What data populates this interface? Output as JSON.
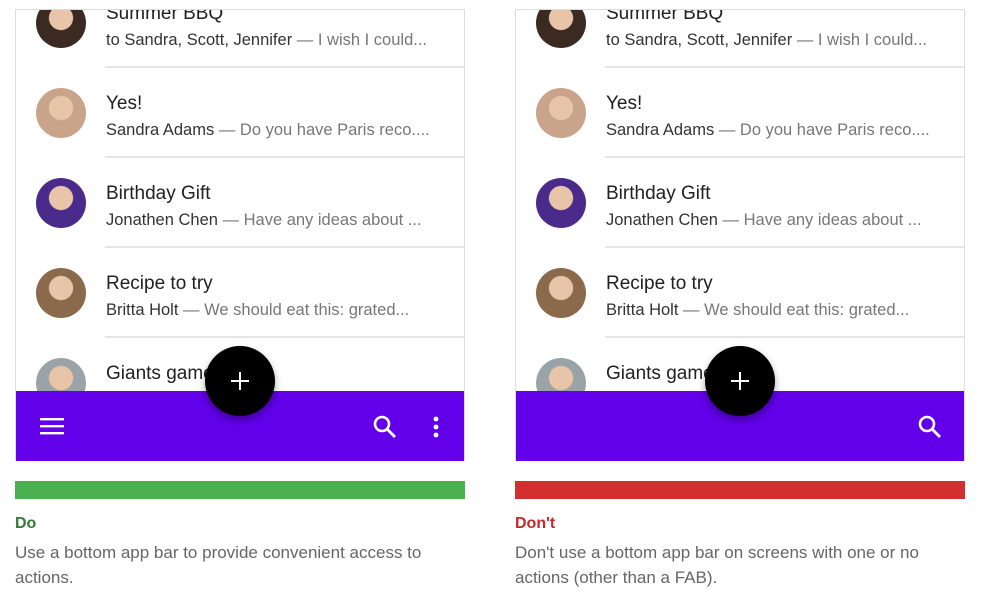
{
  "emails": [
    {
      "title": "Summer BBQ",
      "sender": "to Sandra, Scott, Jennifer",
      "preview": " — I wish I could...",
      "avatar_color": "#3b2a22"
    },
    {
      "title": "Yes!",
      "sender": "Sandra Adams",
      "preview": " — Do you have Paris reco....",
      "avatar_color": "#c9a48a"
    },
    {
      "title": "Birthday Gift",
      "sender": "Jonathen Chen",
      "preview": " — Have any ideas about ...",
      "avatar_color": "#4a2a8a"
    },
    {
      "title": "Recipe to try",
      "sender": "Britta Holt",
      "preview": " — We should eat this: grated...",
      "avatar_color": "#8a6a4a"
    },
    {
      "title": "Giants game",
      "sender": "",
      "preview": "",
      "avatar_color": "#9aa4a8"
    }
  ],
  "colors": {
    "app_bar": "#6200ea",
    "fab": "#000000",
    "do": "#4caf50",
    "dont": "#d32f2f",
    "do_text": "#2e7d32",
    "dont_text": "#c62828"
  },
  "do": {
    "label": "Do",
    "text": "Use a bottom app bar to provide convenient access to actions.",
    "icons": [
      "menu-icon",
      "search-icon",
      "more-vert-icon"
    ]
  },
  "dont": {
    "label": "Don't",
    "text": "Don't use a bottom app bar on screens with one or no actions (other than a FAB).",
    "icons": [
      "search-icon"
    ]
  }
}
